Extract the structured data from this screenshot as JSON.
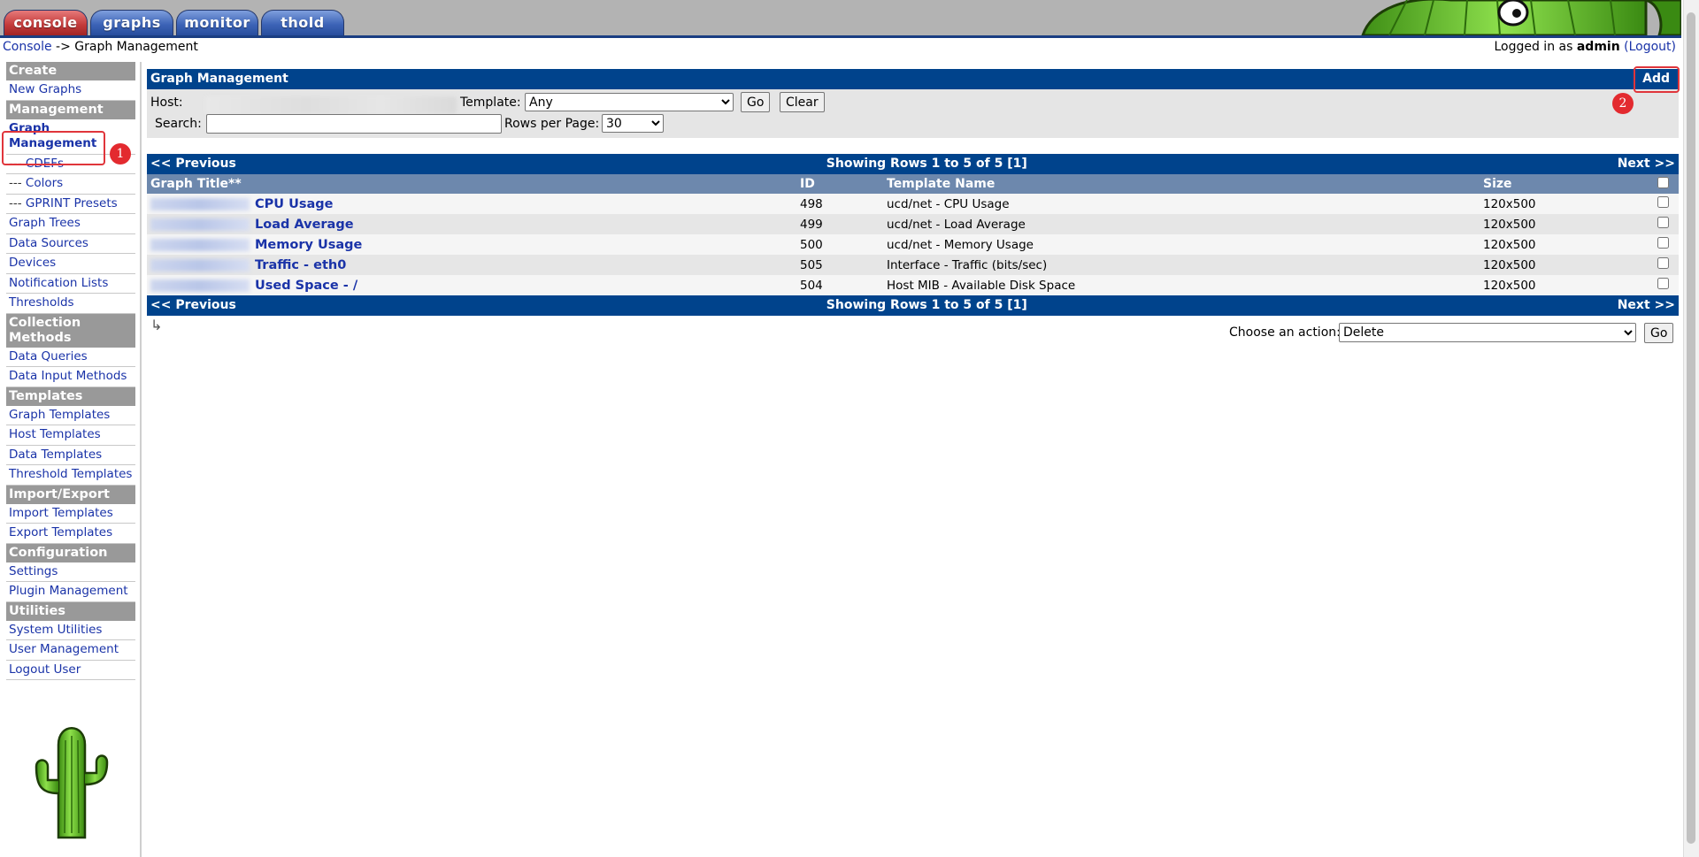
{
  "tabs": [
    {
      "label": "console",
      "style": "red"
    },
    {
      "label": "graphs",
      "style": "blue"
    },
    {
      "label": "monitor",
      "style": "blue"
    },
    {
      "label": "thold",
      "style": "blue"
    }
  ],
  "breadcrumb": {
    "root": "Console",
    "sep": "->",
    "current": "Graph Management"
  },
  "login": {
    "prefix": "Logged in as",
    "user": "admin",
    "logout": "(Logout)"
  },
  "sidebar": {
    "sections": [
      {
        "title": "Create",
        "items": [
          {
            "label": "New Graphs"
          }
        ]
      },
      {
        "title": "Management",
        "items": [
          {
            "label": "Graph Management",
            "selected": true
          },
          {
            "prefix": "---",
            "label": "CDEFs"
          },
          {
            "prefix": "---",
            "label": "Colors"
          },
          {
            "prefix": "---",
            "label": "GPRINT Presets"
          },
          {
            "label": "Graph Trees"
          },
          {
            "label": "Data Sources"
          },
          {
            "label": "Devices"
          },
          {
            "label": "Notification Lists"
          },
          {
            "label": "Thresholds"
          }
        ]
      },
      {
        "title": "Collection Methods",
        "items": [
          {
            "label": "Data Queries"
          },
          {
            "label": "Data Input Methods"
          }
        ]
      },
      {
        "title": "Templates",
        "items": [
          {
            "label": "Graph Templates"
          },
          {
            "label": "Host Templates"
          },
          {
            "label": "Data Templates"
          },
          {
            "label": "Threshold Templates"
          }
        ]
      },
      {
        "title": "Import/Export",
        "items": [
          {
            "label": "Import Templates"
          },
          {
            "label": "Export Templates"
          }
        ]
      },
      {
        "title": "Configuration",
        "items": [
          {
            "label": "Settings"
          },
          {
            "label": "Plugin Management"
          }
        ]
      },
      {
        "title": "Utilities",
        "items": [
          {
            "label": "System Utilities"
          },
          {
            "label": "User Management"
          },
          {
            "label": "Logout User"
          }
        ]
      }
    ]
  },
  "markers": {
    "one": "1",
    "two": "2"
  },
  "panel": {
    "title": "Graph Management",
    "add_label": "Add",
    "host_label": "Host:",
    "template_label": "Template:",
    "template_value": "Any",
    "go_label": "Go",
    "clear_label": "Clear",
    "search_label": "Search:",
    "search_value": "",
    "rows_label": "Rows per Page:",
    "rows_value": "30"
  },
  "nav": {
    "prev": "<< Previous",
    "next": "Next >>",
    "showing": "Showing Rows 1 to 5 of 5 [1]"
  },
  "table": {
    "headers": {
      "title": "Graph Title**",
      "id": "ID",
      "template": "Template Name",
      "size": "Size"
    },
    "rows": [
      {
        "title": "CPU Usage",
        "id": "498",
        "template": "ucd/net - CPU Usage",
        "size": "120x500"
      },
      {
        "title": "Load Average",
        "id": "499",
        "template": "ucd/net - Load Average",
        "size": "120x500"
      },
      {
        "title": "Memory Usage",
        "id": "500",
        "template": "ucd/net - Memory Usage",
        "size": "120x500"
      },
      {
        "title": "Traffic - eth0",
        "id": "505",
        "template": "Interface - Traffic (bits/sec)",
        "size": "120x500"
      },
      {
        "title": "Used Space - /",
        "id": "504",
        "template": "Host MIB - Available Disk Space",
        "size": "120x500"
      }
    ]
  },
  "action": {
    "label": "Choose an action:",
    "value": "Delete",
    "go_label": "Go"
  },
  "icons": {
    "return_arrow": "↳",
    "logo": "cactus-icon"
  },
  "colors": {
    "header_blue": "#00438c",
    "table_header": "#6d88ad",
    "sidebar_head": "#999999",
    "highlight": "#e0353b"
  }
}
